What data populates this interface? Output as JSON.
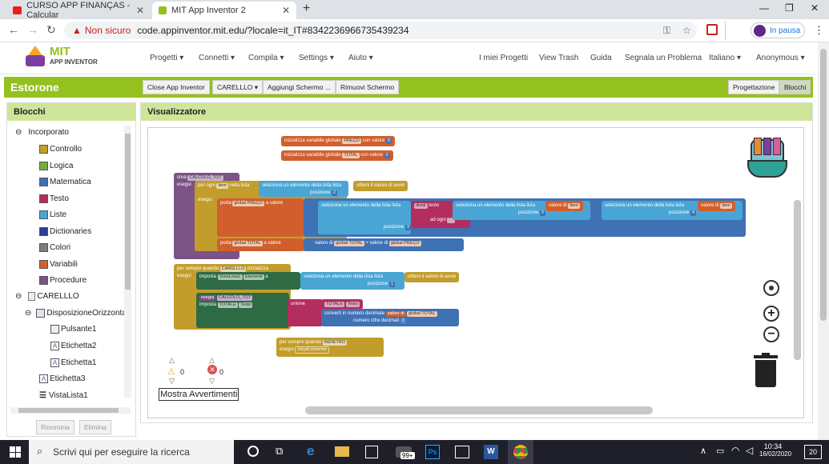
{
  "browser": {
    "tabs": [
      "CURSO APP FINANÇAS - Calcular",
      "MIT App Inventor 2"
    ],
    "insecure": "Non sicuro",
    "url": "code.appinventor.mit.edu/?locale=it_IT#8342236966735439234",
    "profile": "In pausa"
  },
  "header": {
    "brand_top": "MIT",
    "brand_bottom": "APP INVENTOR",
    "menus": [
      "Progetti",
      "Connetti",
      "Compila",
      "Settings",
      "Aiuto"
    ],
    "links": [
      "I miei Progetti",
      "View Trash",
      "Guida",
      "Segnala un Problema",
      "Italiano",
      "Anonymous"
    ]
  },
  "project": {
    "name": "Estorone",
    "buttons": [
      "Close App Inventor",
      "CARELLLO",
      "Aggiungi Schermo ...",
      "Rimuovi Schermo"
    ],
    "modes": [
      "Progettazione",
      "Blocchi"
    ]
  },
  "blocks_panel": {
    "title": "Blocchi",
    "builtin": "Incorporato",
    "items": [
      {
        "label": "Controllo",
        "color": "#c29d2b"
      },
      {
        "label": "Logica",
        "color": "#77ab41"
      },
      {
        "label": "Matematica",
        "color": "#3f71b5"
      },
      {
        "label": "Testo",
        "color": "#b32d5e"
      },
      {
        "label": "Liste",
        "color": "#49a6d4"
      },
      {
        "label": "Dictionaries",
        "color": "#2d3c95"
      },
      {
        "label": "Colori",
        "color": "#7d7d7d"
      },
      {
        "label": "Variabili",
        "color": "#d05f2d"
      },
      {
        "label": "Procedure",
        "color": "#7c5385"
      }
    ],
    "screen": "CARELLLO",
    "components": [
      "DisposizioneOrizzonta",
      "Pulsante1",
      "Etichetta2",
      "Etichetta1",
      "Etichetta3",
      "VistaLista1"
    ],
    "rename": "Rinomina",
    "delete": "Elimina"
  },
  "viewer": {
    "title": "Visualizzatore",
    "warnings": "0",
    "errors": "0",
    "show_warnings": "Mostra Avvertimenti"
  },
  "blocks": {
    "g1": "inizializza variabile globale",
    "preco": "PREÇO",
    "con_valore": "con valore",
    "zero": "0",
    "total": "TOTAL",
    "crea": "crea",
    "calc": "CALCOLO_TOT",
    "esegui": "esegui",
    "per_ogni": "per ogni",
    "item": "item",
    "nella_lista": "nella lista",
    "seleziona": "seleziona un elemento della lista  lista",
    "ottieni": "ottieni il valore di avvio",
    "posizione": "posizione",
    "two": "2",
    "porta": "porta",
    "gpreco": "global PREÇO",
    "a_valore": "a valore",
    "dividi": "dividi",
    "testo": "testo",
    "ad_ogni": "ad ogni",
    "quote": "\" \"",
    "valore_di": "valore di",
    "three": "3",
    "four": "4",
    "gtotal": "global TOTAL",
    "plus": "+",
    "quando": "per sempre quando",
    "carello": "CARELLLO",
    "inizializza": ".Inizializza",
    "imposta": "imposta",
    "vista": "VistaLista1",
    "elementi": "Elementi",
    "a": "a",
    "one": "1",
    "unione": "unione",
    "testo_tot": "TOTALE",
    "testo_comp": "Testo",
    "converti": "converti in numero decimale",
    "numero_cifre": "numero cifre decimali",
    "indietro": "INDIETRO",
    ".cliccato": ".Cliccato",
    "chiudi": "chiudi schermo"
  },
  "taskbar": {
    "search": "Scrivi qui per eseguire la ricerca",
    "badge": "99+",
    "time": "10:34",
    "date": "16/02/2020",
    "notif": "20"
  }
}
